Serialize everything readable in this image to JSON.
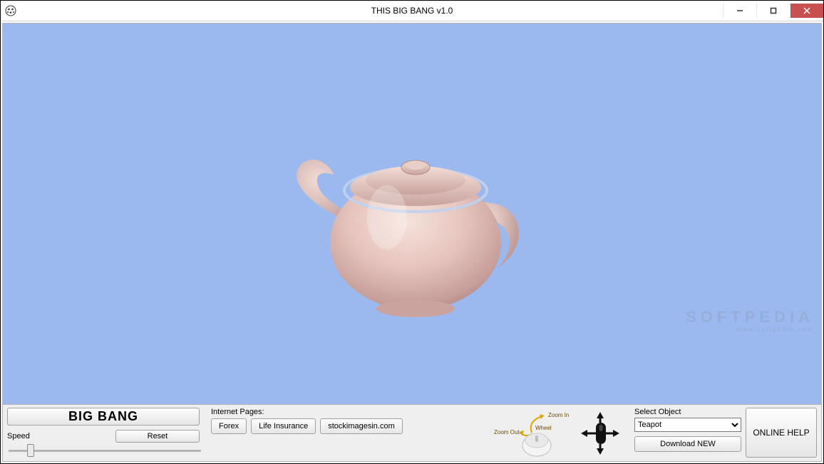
{
  "window": {
    "title": "THIS BIG BANG v1.0"
  },
  "controls": {
    "big_bang_label": "BIG  BANG",
    "speed_label": "Speed",
    "reset_label": "Reset",
    "speed_value": 10
  },
  "internet": {
    "legend": "Internet Pages:",
    "forex": "Forex",
    "life_insurance": "Life Insurance",
    "stockimages": "stockimagesin.com"
  },
  "hints": {
    "zoom_in": "Zoom In",
    "wheel": "Wheel",
    "zoom_out": "Zoom Out"
  },
  "select": {
    "label": "Select Object",
    "value": "Teapot",
    "download": "Download NEW"
  },
  "help": {
    "label": "ONLINE HELP"
  },
  "watermark": {
    "main": "SOFTPEDIA",
    "sub": "www.softpedia.com"
  }
}
